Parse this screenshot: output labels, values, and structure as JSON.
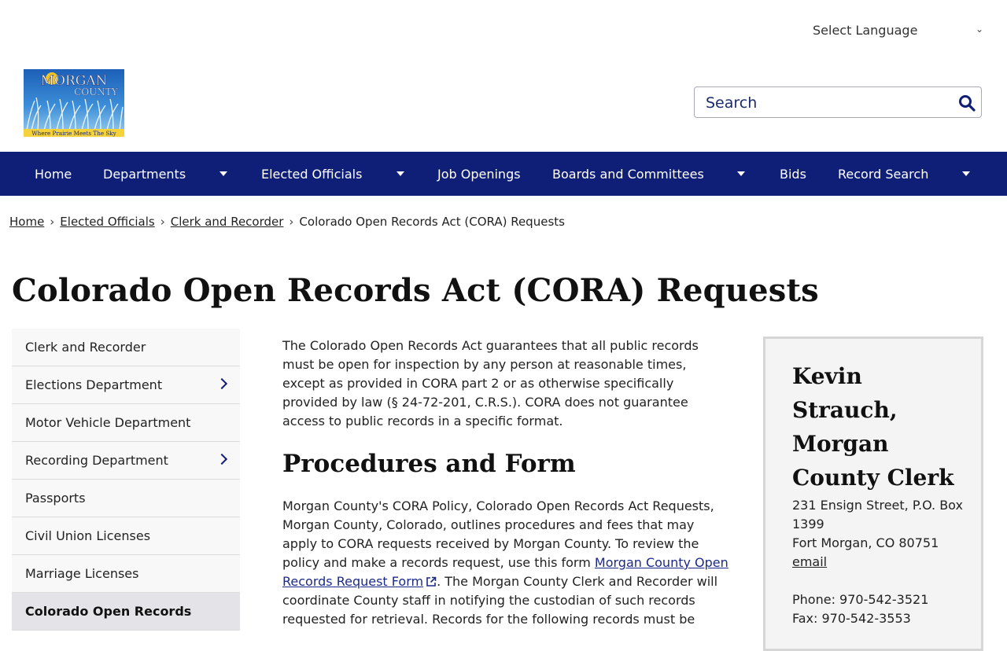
{
  "language": {
    "label": "Select Language"
  },
  "logo": {
    "title": "MORGAN",
    "subtitle": "COUNTY",
    "tagline": "Where Prairie Meets The Sky"
  },
  "search": {
    "placeholder": "Search"
  },
  "nav": {
    "items": [
      {
        "label": "Home"
      },
      {
        "label": "Departments"
      },
      {
        "label": "Elected Officials"
      },
      {
        "label": "Job Openings"
      },
      {
        "label": "Boards and Committees"
      },
      {
        "label": "Bids"
      },
      {
        "label": "Record Search"
      }
    ]
  },
  "breadcrumb": {
    "items": [
      "Home",
      "Elected Officials",
      "Clerk and Recorder"
    ],
    "current": "Colorado Open Records Act (CORA) Requests",
    "separator": "›"
  },
  "page": {
    "title": "Colorado Open Records Act (CORA) Requests"
  },
  "sidebar": {
    "items": [
      {
        "label": "Clerk and Recorder"
      },
      {
        "label": "Elections Department"
      },
      {
        "label": "Motor Vehicle Department"
      },
      {
        "label": "Recording Department"
      },
      {
        "label": "Passports"
      },
      {
        "label": "Civil Union Licenses"
      },
      {
        "label": "Marriage Licenses"
      },
      {
        "label": "Colorado Open Records"
      }
    ]
  },
  "main": {
    "intro": "The Colorado Open Records Act guarantees that all public records must be open for inspection by any person at reasonable times, except as provided in CORA part 2 or as otherwise specifically provided by law (§ 24-72-201, C.R.S.). CORA does not guarantee access to public records in a specific format.",
    "heading": "Procedures and Form",
    "para_before_link": "Morgan County's CORA Policy, Colorado Open Records Act Requests, Morgan County, Colorado, outlines procedures and fees that may apply to CORA requests received by Morgan County. To review the policy and make a records request, use this form ",
    "link_text": "Morgan County Open Records Request Form",
    "para_after_link": ". The Morgan County Clerk and Recorder will coordinate County staff in notifying the custodian of such records requested for retrieval. Records for the following records must be"
  },
  "contact": {
    "name": "Kevin Strauch, Morgan County Clerk",
    "address_line1": "231 Ensign Street, P.O. Box 1399",
    "address_line2": "Fort Morgan, CO 80751",
    "email_label": "email",
    "phone": "Phone: 970-542-3521",
    "fax": "Fax: 970-542-3553"
  },
  "colors": {
    "nav_bg": "#0f1f77",
    "link": "#1b2a8a"
  }
}
